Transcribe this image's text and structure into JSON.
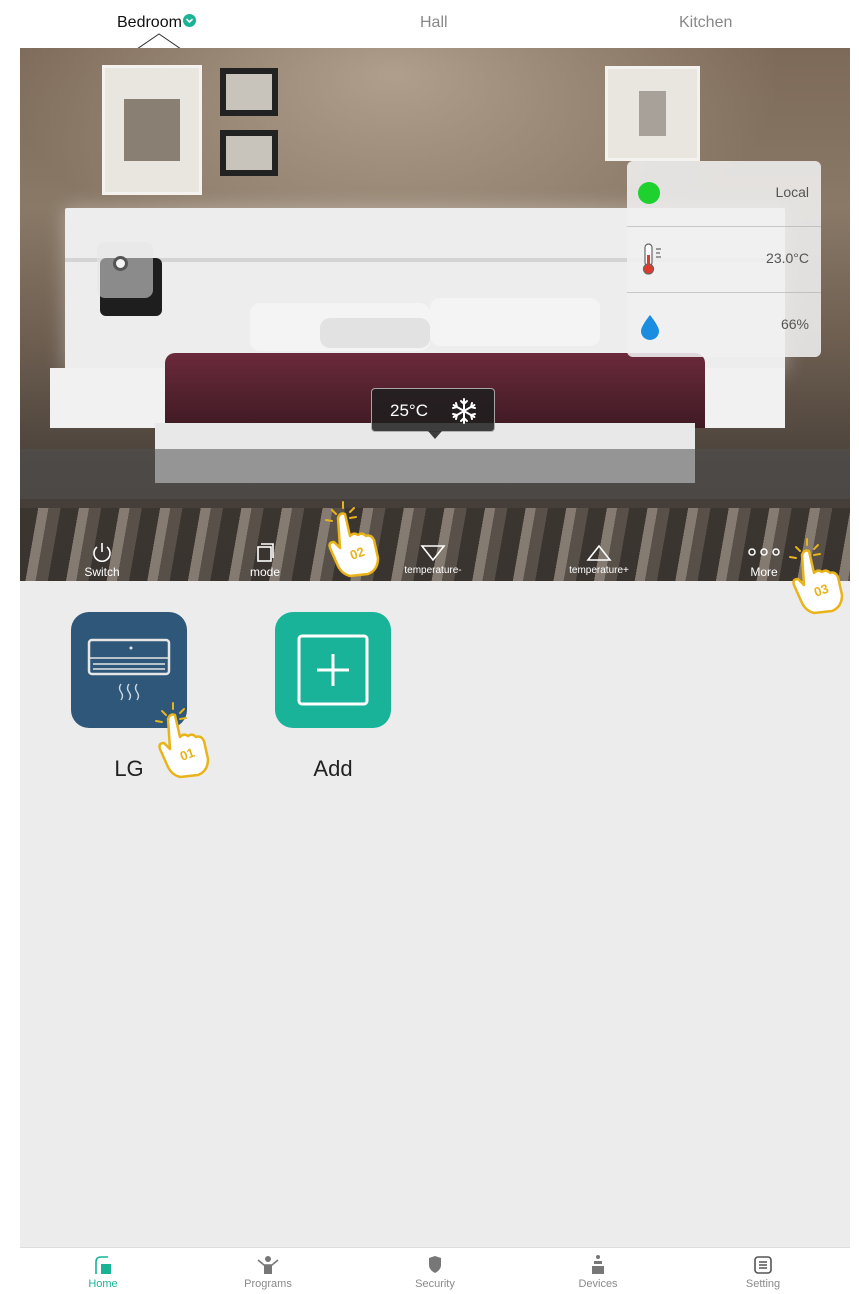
{
  "tabs": [
    {
      "label": "Bedroom",
      "active": true
    },
    {
      "label": "Hall",
      "active": false
    },
    {
      "label": "Kitchen",
      "active": false
    }
  ],
  "info_panel": {
    "connection": "Local",
    "temperature": "23.0°C",
    "humidity": "66%",
    "status_color": "#1ed12f"
  },
  "popup": {
    "temperature": "25°C",
    "mode_icon": "snowflake-icon"
  },
  "controls": [
    {
      "label": "Switch",
      "icon": "power-icon"
    },
    {
      "label": "mode",
      "icon": "mode-icon"
    },
    {
      "label": "temperature-",
      "icon": "triangle-down-icon"
    },
    {
      "label": "temperature+",
      "icon": "triangle-up-icon"
    },
    {
      "label": "More",
      "icon": "more-dots-icon"
    }
  ],
  "annotations": [
    "01",
    "02",
    "03"
  ],
  "devices": [
    {
      "name": "LG",
      "icon": "air-conditioner-icon",
      "color": "#2e5779"
    },
    {
      "name": "Add",
      "icon": "add-icon",
      "color": "#19b39a"
    }
  ],
  "bottom_nav": [
    {
      "label": "Home",
      "icon": "home-icon",
      "active": true
    },
    {
      "label": "Programs",
      "icon": "programs-icon",
      "active": false
    },
    {
      "label": "Security",
      "icon": "shield-icon",
      "active": false
    },
    {
      "label": "Devices",
      "icon": "devices-icon",
      "active": false
    },
    {
      "label": "Setting",
      "icon": "setting-icon",
      "active": false
    }
  ],
  "colors": {
    "accent": "#1ab394",
    "annotation": "#e9b31a"
  }
}
